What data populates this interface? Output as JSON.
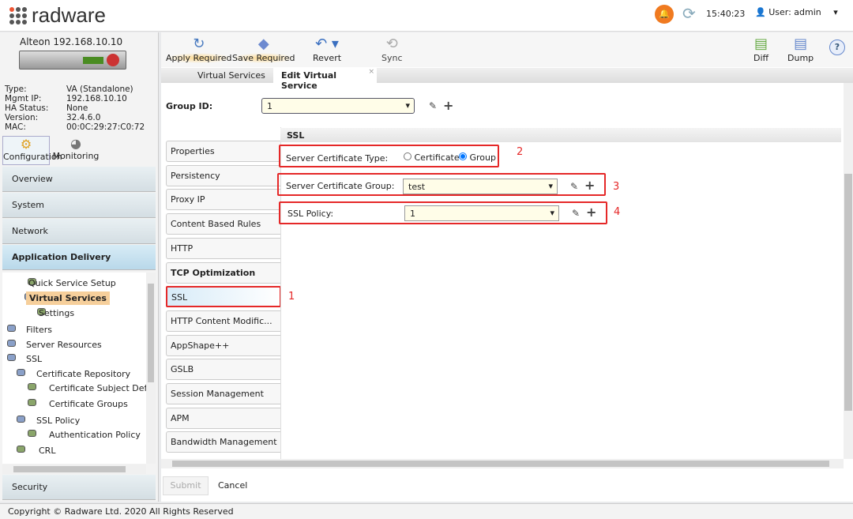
{
  "header": {
    "brand": "radware",
    "time": "15:40:23",
    "user": "User: admin"
  },
  "device": {
    "name": "Alteon 192.168.10.10",
    "info": [
      [
        "Type:",
        "VA (Standalone)"
      ],
      [
        "Mgmt IP:",
        "192.168.10.10"
      ],
      [
        "HA Status:",
        "None"
      ],
      [
        "Version:",
        "32.4.6.0"
      ],
      [
        "MAC:",
        "00:0C:29:27:C0:72"
      ]
    ]
  },
  "modes": {
    "configuration": "Configuration",
    "monitoring": "Monitoring"
  },
  "nav": {
    "overview": "Overview",
    "system": "System",
    "network": "Network",
    "app_delivery": "Application Delivery",
    "security": "Security"
  },
  "tree": [
    "Quick Service Setup",
    "Virtual Services",
    "Settings",
    "Filters",
    "Server Resources",
    "SSL",
    "Certificate Repository",
    "Certificate Subject Defaul",
    "Certificate Groups",
    "SSL Policy",
    "Authentication Policy",
    "CRL"
  ],
  "toolbar": {
    "apply": "Apply Required",
    "save": "Save Required",
    "revert": "Revert",
    "sync": "Sync",
    "diff": "Diff",
    "dump": "Dump",
    "help": "?"
  },
  "tabs": {
    "virtual_services": "Virtual Services",
    "edit": "Edit Virtual Service"
  },
  "group": {
    "label": "Group ID:",
    "value": "1"
  },
  "side_tabs": [
    "Properties",
    "Persistency",
    "Proxy IP",
    "Content Based Rules",
    "HTTP",
    "TCP Optimization",
    "SSL",
    "HTTP Content Modific...",
    "AppShape++",
    "GSLB",
    "Session Management",
    "APM",
    "Bandwidth Management"
  ],
  "ssl": {
    "title": "SSL",
    "cert_type_label": "Server Certificate Type:",
    "opt_certificate": "Certificate",
    "opt_group": "Group",
    "cert_group_label": "Server Certificate Group:",
    "cert_group_value": "test",
    "policy_label": "SSL Policy:",
    "policy_value": "1"
  },
  "annotations": [
    "1",
    "2",
    "3",
    "4"
  ],
  "buttons": {
    "submit": "Submit",
    "cancel": "Cancel"
  },
  "footer": "Copyright © Radware Ltd. 2020 All Rights Reserved"
}
